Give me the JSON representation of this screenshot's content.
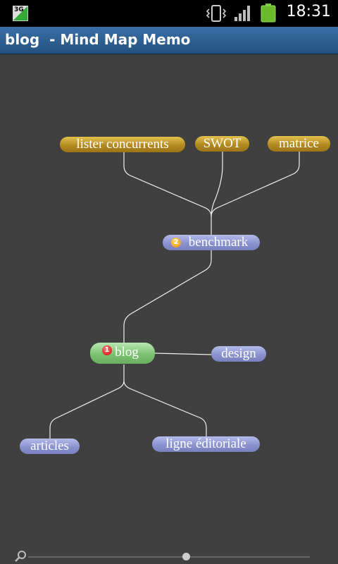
{
  "status_bar": {
    "network_label": "3G",
    "time": "18:31",
    "icons": [
      "network-3g-icon",
      "vibrate-icon",
      "signal-icon",
      "battery-icon"
    ]
  },
  "title_bar": {
    "title": "blog  - Mind Map Memo"
  },
  "mind_map": {
    "central": {
      "label": "blog",
      "badge": "1"
    },
    "benchmark": {
      "label": "benchmark",
      "badge": "2"
    },
    "nodes": {
      "lister": "lister concurrents",
      "swot": "SWOT",
      "matrice": "matrice",
      "design": "design",
      "articles": "articles",
      "ligne": "ligne éditoriale"
    }
  },
  "zoom": {
    "icon": "zoom-icon",
    "level_fraction": 0.56
  },
  "colors": {
    "canvas_bg": "#404040",
    "title_bar": "#2f5f91",
    "topic_gold": "#c9a23a",
    "topic_blue": "#8a93cf",
    "central_green": "#7dc173"
  }
}
